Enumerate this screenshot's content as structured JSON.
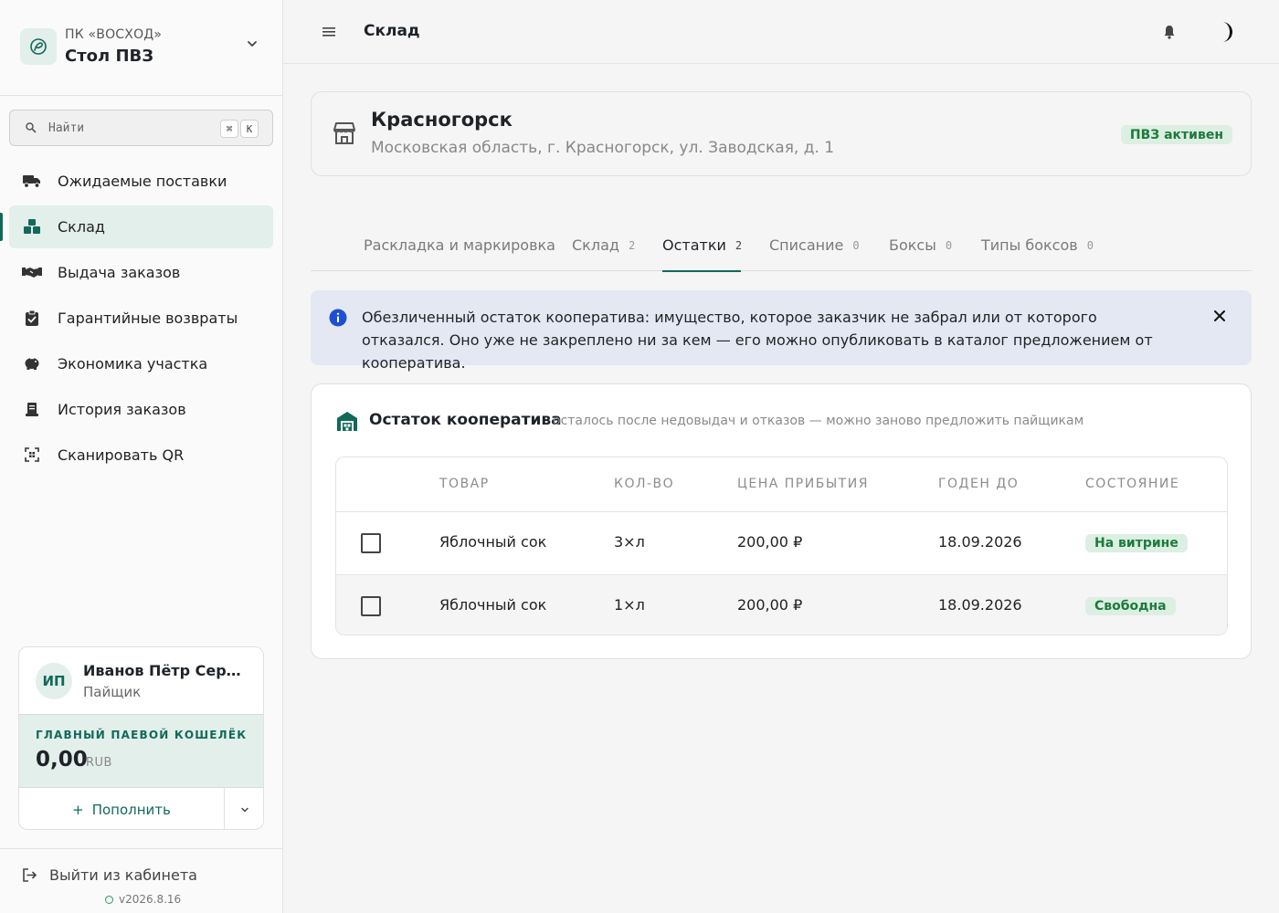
{
  "sidebar": {
    "org": "ПК «ВОСХОД»",
    "title": "Стол ПВЗ",
    "search": {
      "placeholder": "Найти",
      "kbd1": "⌘",
      "kbd2": "K"
    },
    "items": [
      {
        "label": "Ожидаемые поставки",
        "icon": "truck-icon"
      },
      {
        "label": "Склад",
        "icon": "boxes-icon"
      },
      {
        "label": "Выдача заказов",
        "icon": "handshake-icon"
      },
      {
        "label": "Гарантийные возвраты",
        "icon": "clipboard-check-icon"
      },
      {
        "label": "Экономика участка",
        "icon": "piggy-bank-icon"
      },
      {
        "label": "История заказов",
        "icon": "receipt-icon"
      },
      {
        "label": "Сканировать QR",
        "icon": "qr-scan-icon"
      }
    ],
    "user": {
      "initials": "ИП",
      "name": "Иванов Пётр Сергеевич",
      "role": "Пайщик",
      "wallet_label": "ГЛАВНЫЙ ПАЕВОЙ КОШЕЛЁК",
      "amount": "0,00",
      "currency": "RUB",
      "topup_label": "Пополнить"
    },
    "logout_label": "Выйти из кабинета",
    "version": "v2026.8.16"
  },
  "topbar": {
    "title": "Склад"
  },
  "location": {
    "city": "Красногорск",
    "address": "Московская область, г. Красногорск, ул. Заводская, д. 1",
    "badge": "ПВЗ активен"
  },
  "tabs": [
    {
      "label": "Раскладка и маркировка",
      "count": ""
    },
    {
      "label": "Склад",
      "count": "2"
    },
    {
      "label": "Остатки",
      "count": "2"
    },
    {
      "label": "Списание",
      "count": "0"
    },
    {
      "label": "Боксы",
      "count": "0"
    },
    {
      "label": "Типы боксов",
      "count": "0"
    }
  ],
  "info": {
    "text": "Обезличенный остаток кооператива: имущество, которое заказчик не забрал или от которого отказался. Оно уже не закреплено ни за кем — его можно опубликовать в каталог предложением от кооператива."
  },
  "stock": {
    "title": "Остаток кооператива",
    "subtitle": "осталось после недовыдач и отказов — можно заново предложить пайщикам",
    "columns": [
      "ТОВАР",
      "КОЛ-ВО",
      "ЦЕНА ПРИБЫТИЯ",
      "ГОДЕН ДО",
      "СОСТОЯНИЕ"
    ],
    "rows": [
      {
        "product": "Яблочный сок",
        "qty": "3×л",
        "price": "200,00 ₽",
        "expires": "18.09.2026",
        "status": "На витрине"
      },
      {
        "product": "Яблочный сок",
        "qty": "1×л",
        "price": "200,00 ₽",
        "expires": "18.09.2026",
        "status": "Свободна"
      }
    ]
  },
  "colors": {
    "accent": "#11695a",
    "accent_soft": "#e3efea",
    "success": "#1d7a3c",
    "info_bg": "#e4e8f2",
    "info_icon": "#1f4fd1"
  }
}
